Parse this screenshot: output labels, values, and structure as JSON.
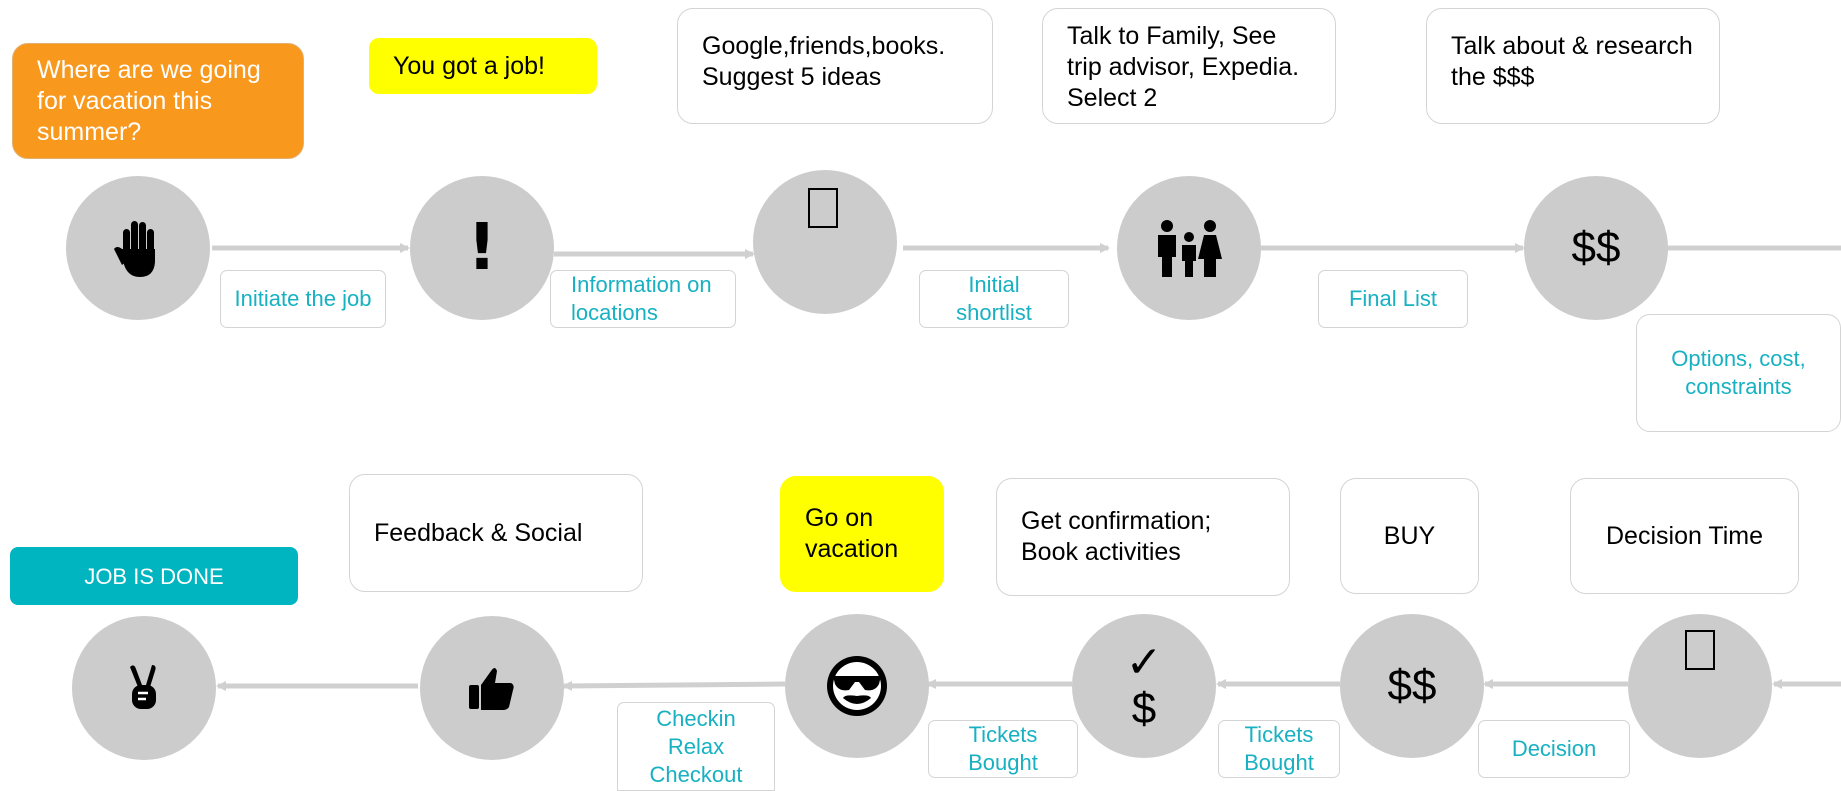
{
  "colors": {
    "circle": "#cccccc",
    "arrow": "#d0d0d0",
    "label_text": "#17b1c2",
    "orange": "#f8981d",
    "yellow": "#ffff00",
    "teal": "#00b5c0"
  },
  "top_row": {
    "start_box": "Where are we going for vacation this summer?",
    "trigger_box": "You got a job!",
    "steps": [
      {
        "icon": "raised-hand-icon",
        "note": "",
        "label": "Initiate the job"
      },
      {
        "icon": "exclamation-icon",
        "note": "",
        "label": "Information on locations"
      },
      {
        "icon": "placeholder-icon",
        "note": "Google,friends,books. Suggest 5 ideas",
        "label": "Initial shortlist"
      },
      {
        "icon": "family-icon",
        "note": "Talk to Family, See trip advisor, Expedia. Select 2",
        "label": "Final List"
      },
      {
        "icon": "money-icon",
        "symbol": "$$",
        "note": "Talk about & research the $$$",
        "label": "Options, cost, constraints"
      }
    ]
  },
  "bottom_row": {
    "done_box": "JOB IS DONE",
    "steps": [
      {
        "icon": "placeholder-icon",
        "note": "Decision Time",
        "label": "Decision"
      },
      {
        "icon": "money-icon",
        "symbol": "$$",
        "note": "BUY",
        "label": "Tickets Bought"
      },
      {
        "icon": "check-dollar-icon",
        "symbol_top": "✓",
        "symbol_bottom": "$",
        "note": "Get confirmation; Book activities",
        "label": "Tickets Bought"
      },
      {
        "icon": "sunglasses-face-icon",
        "note": "Go on vacation",
        "label": "Checkin Relax Checkout"
      },
      {
        "icon": "thumbs-up-icon",
        "note": "Feedback & Social",
        "label": ""
      },
      {
        "icon": "victory-hand-icon",
        "note": "",
        "label": ""
      }
    ]
  }
}
